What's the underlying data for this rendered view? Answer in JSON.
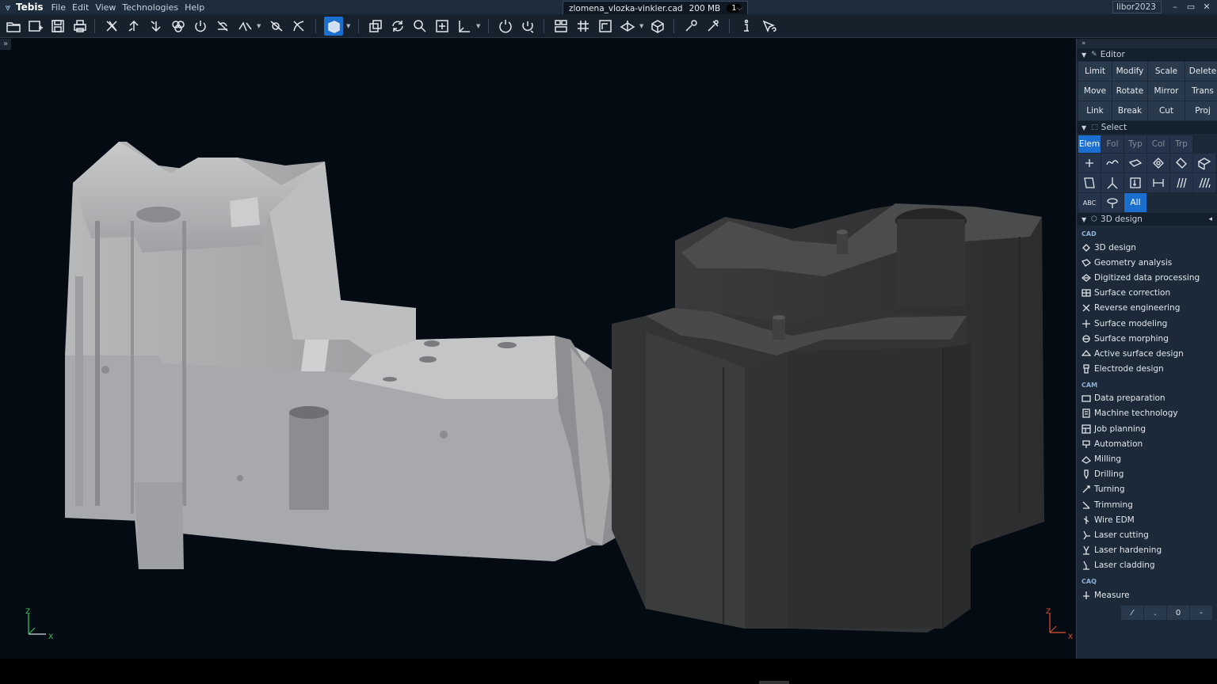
{
  "app": {
    "name": "Tebis",
    "menu": [
      "File",
      "Edit",
      "View",
      "Technologies",
      "Help"
    ],
    "file_tab": {
      "name": "zlomena_vlozka-vinkler.cad",
      "size": "200 MB",
      "count": "1"
    },
    "user": "libor2023",
    "window_controls": [
      "–",
      "▭",
      "✕"
    ]
  },
  "toolbar": {
    "icons": [
      "open-file-icon",
      "new-window-icon",
      "save-icon",
      "print-icon",
      "delete-icon",
      "undo-icon",
      "redo-icon",
      "layers-icon",
      "power-icon",
      "hide-icon",
      "text-select-icon",
      "filter-icon",
      "pick-filter-icon",
      "shaded-view-icon",
      "copy-view-icon",
      "refresh-icon",
      "zoom-icon",
      "fit-view-icon",
      "axis-icon",
      "rotate-icon",
      "rotate-axis-icon",
      "snap-grid-icon",
      "grid-icon",
      "frame-icon",
      "plane-icon",
      "box-view-icon",
      "settings-icon",
      "measure-tool-icon",
      "info-icon",
      "help-pointer-icon"
    ]
  },
  "viewport": {
    "axes_left": {
      "z": "Z",
      "x": "X"
    },
    "axes_right": {
      "z": "Z",
      "x": "X"
    }
  },
  "panel": {
    "editor": {
      "title": "Editor",
      "buttons": [
        "Limit",
        "Modify",
        "Scale",
        "Delete",
        "Move",
        "Rotate",
        "Mirror",
        "Trans",
        "Link",
        "Break",
        "Cut",
        "Proj"
      ]
    },
    "select": {
      "title": "Select",
      "tabs": [
        "Elem",
        "Fol",
        "Typ",
        "Col",
        "Trp"
      ],
      "all_label": "All",
      "abc_label": "ABC"
    },
    "design": {
      "title": "3D design",
      "groups": [
        {
          "label": "CAD",
          "items": [
            "3D design",
            "Geometry analysis",
            "Digitized data processing",
            "Surface correction",
            "Reverse engineering",
            "Surface modeling",
            "Surface morphing",
            "Active surface design",
            "Electrode design"
          ]
        },
        {
          "label": "CAM",
          "items": [
            "Data preparation",
            "Machine technology",
            "Job planning",
            "Automation",
            "Milling",
            "Drilling",
            "Turning",
            "Trimming",
            "Wire EDM",
            "Laser cutting",
            "Laser hardening",
            "Laser cladding"
          ]
        },
        {
          "label": "CAQ",
          "items": [
            "Measure"
          ]
        }
      ]
    },
    "calc": [
      "⁄",
      ".",
      "0",
      "-"
    ]
  },
  "colors": {
    "accent": "#1a6fcf",
    "panel": "#1c2938",
    "viewport": "#050b12"
  }
}
